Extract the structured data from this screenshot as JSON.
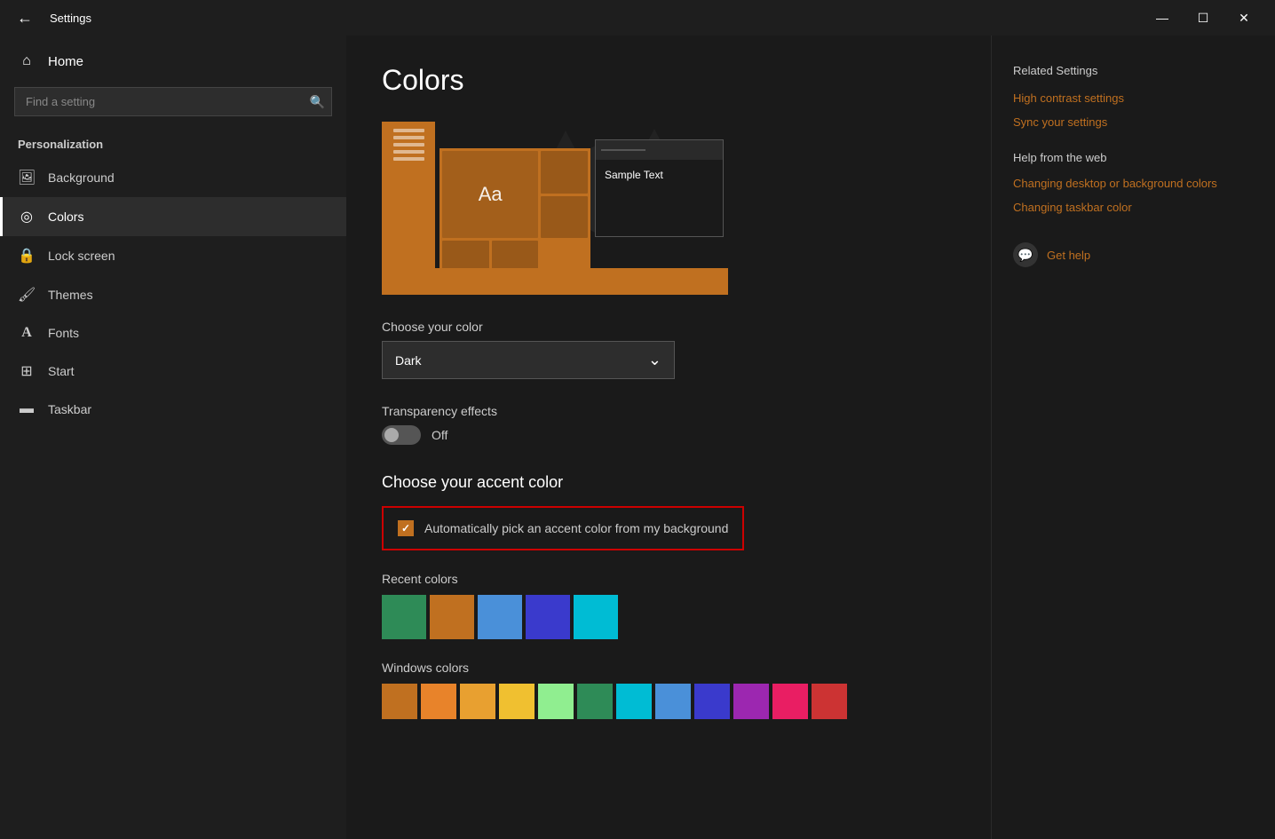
{
  "titlebar": {
    "app_name": "Settings",
    "back_arrow": "←",
    "minimize": "—",
    "maximize": "☐",
    "close": "✕"
  },
  "sidebar": {
    "home_label": "Home",
    "search_placeholder": "Find a setting",
    "section_label": "Personalization",
    "items": [
      {
        "id": "background",
        "label": "Background",
        "icon": "🖼"
      },
      {
        "id": "colors",
        "label": "Colors",
        "icon": "🎨",
        "active": true
      },
      {
        "id": "lock-screen",
        "label": "Lock screen",
        "icon": "🔒"
      },
      {
        "id": "themes",
        "label": "Themes",
        "icon": "🖌"
      },
      {
        "id": "fonts",
        "label": "Fonts",
        "icon": "A"
      },
      {
        "id": "start",
        "label": "Start",
        "icon": "⊞"
      },
      {
        "id": "taskbar",
        "label": "Taskbar",
        "icon": "▬"
      }
    ]
  },
  "main": {
    "title": "Colors",
    "preview": {
      "sample_text": "Sample Text",
      "aa_label": "Aa"
    },
    "choose_color_label": "Choose your color",
    "color_dropdown_value": "Dark",
    "color_dropdown_chevron": "⌄",
    "transparency_label": "Transparency effects",
    "transparency_state": "Off",
    "accent_section_title": "Choose your accent color",
    "auto_accent_label": "Automatically pick an accent color from my background",
    "recent_colors_label": "Recent colors",
    "recent_colors": [
      {
        "hex": "#2e8b57"
      },
      {
        "hex": "#c07020"
      },
      {
        "hex": "#4a90d9"
      },
      {
        "hex": "#3a3acc"
      },
      {
        "hex": "#00bcd4"
      }
    ],
    "windows_colors_label": "Windows colors",
    "windows_colors": [
      "#c07020",
      "#e8832a",
      "#e8a030",
      "#f0c030",
      "#90ee90",
      "#2e8b57",
      "#00bcd4",
      "#4a90d9",
      "#3a3acc",
      "#9c27b0",
      "#e91e63",
      "#cc3333"
    ]
  },
  "related": {
    "title": "Related Settings",
    "links": [
      "High contrast settings",
      "Sync your settings",
      "Changing desktop or background colors",
      "Changing taskbar color"
    ],
    "help_label": "Get help",
    "help_icon": "💬"
  }
}
